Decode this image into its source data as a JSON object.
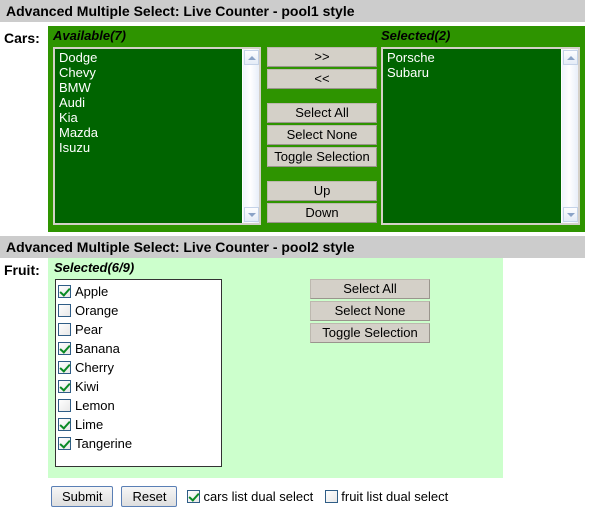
{
  "pool1": {
    "title": "Advanced Multiple Select: Live Counter - pool1 style",
    "field_label": "Cars:",
    "available_caption": "Available(7)",
    "selected_caption": "Selected(2)",
    "available_items": [
      "Dodge",
      "Chevy",
      "BMW",
      "Audi",
      "Kia",
      "Mazda",
      "Isuzu"
    ],
    "selected_items": [
      "Porsche",
      "Subaru"
    ],
    "buttons": {
      "move_right": ">>",
      "move_left": "<<",
      "select_all": "Select All",
      "select_none": "Select None",
      "toggle_selection": "Toggle Selection",
      "up": "Up",
      "down": "Down"
    },
    "panel_color": "#2e9400",
    "list_color": "#006400"
  },
  "pool2": {
    "title": "Advanced Multiple Select: Live Counter - pool2 style",
    "field_label": "Fruit:",
    "selected_caption": "Selected(6/9)",
    "items": [
      {
        "label": "Apple",
        "checked": true
      },
      {
        "label": "Orange",
        "checked": false
      },
      {
        "label": "Pear",
        "checked": false
      },
      {
        "label": "Banana",
        "checked": true
      },
      {
        "label": "Cherry",
        "checked": true
      },
      {
        "label": "Kiwi",
        "checked": true
      },
      {
        "label": "Lemon",
        "checked": false
      },
      {
        "label": "Lime",
        "checked": true
      },
      {
        "label": "Tangerine",
        "checked": true
      }
    ],
    "buttons": {
      "select_all": "Select All",
      "select_none": "Select None",
      "toggle_selection": "Toggle Selection"
    },
    "panel_color": "#ccffcc"
  },
  "form": {
    "submit_label": "Submit",
    "reset_label": "Reset",
    "checks": [
      {
        "label": "cars list dual select",
        "checked": true
      },
      {
        "label": "fruit list dual select",
        "checked": false
      }
    ]
  }
}
